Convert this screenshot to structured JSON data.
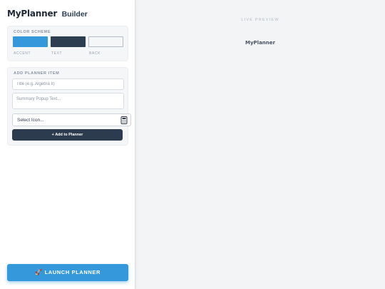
{
  "brand": {
    "name": "MyPlanner",
    "subtitle": "Builder"
  },
  "color_scheme": {
    "title": "COLOR SCHEME",
    "swatches": [
      {
        "label": "ACCENT",
        "color": "#3498db"
      },
      {
        "label": "TEXT",
        "color": "#2c3e50"
      },
      {
        "label": "BACK",
        "color": "#f4f6f8"
      }
    ]
  },
  "add_item": {
    "title": "ADD PLANNER ITEM",
    "title_placeholder": "Title (e.g. Algebra II)",
    "summary_placeholder": "Summary Popup Text...",
    "icon_select": {
      "value": "Select Icon...",
      "icon": "calculator-icon"
    },
    "add_button": "+ Add to Planner"
  },
  "launch_button": {
    "label": "LAUNCH PLANNER",
    "icon": "rocket-icon"
  },
  "preview": {
    "label": "LIVE PREVIEW",
    "brand": "MyPlanner"
  }
}
